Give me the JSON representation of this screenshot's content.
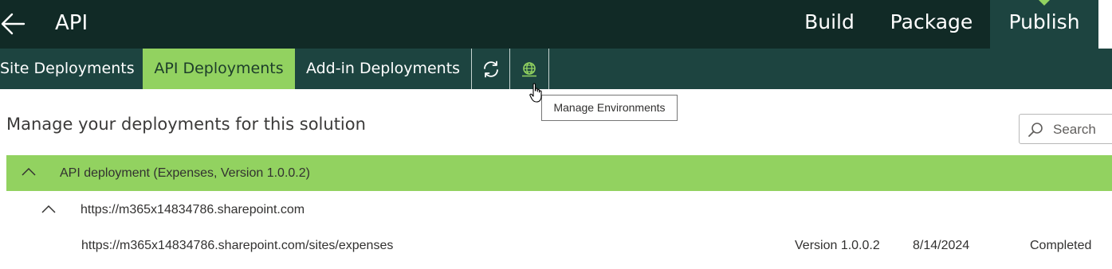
{
  "header": {
    "back_icon": "arrow-left-icon",
    "title": "API",
    "tabs": [
      {
        "label": "Build",
        "active": false
      },
      {
        "label": "Package",
        "active": false
      },
      {
        "label": "Publish",
        "active": true
      }
    ]
  },
  "subnav": {
    "tabs": [
      {
        "label": "Site Deployments",
        "active": false
      },
      {
        "label": "API Deployments",
        "active": true
      },
      {
        "label": "Add-in Deployments",
        "active": false
      }
    ],
    "refresh_icon": "refresh-icon",
    "environments_icon": "globe-icon"
  },
  "tooltip": "Manage Environments",
  "main": {
    "heading": "Manage your deployments for this solution",
    "search": {
      "placeholder": "Search",
      "value": ""
    }
  },
  "deployments": {
    "group_title": "API deployment (Expenses, Version 1.0.0.2)",
    "site_url": "https://m365x14834786.sharepoint.com",
    "items": [
      {
        "url": "https://m365x14834786.sharepoint.com/sites/expenses",
        "version": "Version 1.0.0.2",
        "date": "8/14/2024",
        "status": "Completed"
      }
    ]
  },
  "colors": {
    "header_bg": "#112a26",
    "subnav_bg": "#1d4440",
    "accent_green": "#92d260"
  }
}
